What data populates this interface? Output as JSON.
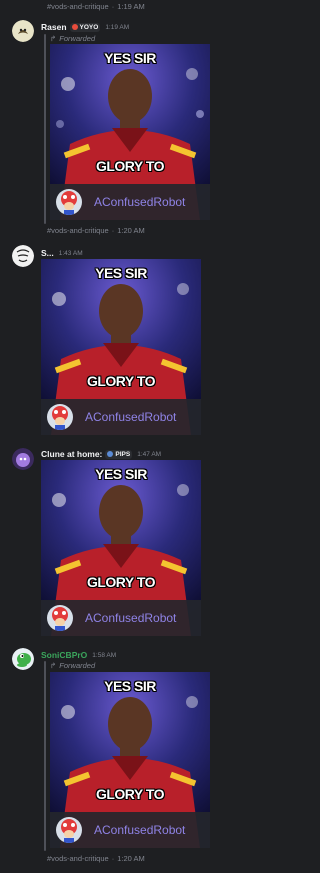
{
  "channel": {
    "prefix": "#",
    "name": "vods-and-critique",
    "separator": "·"
  },
  "messages": [
    {
      "author": "Rasen",
      "tag": "YOYO",
      "time": "1:19 AM",
      "forwarded_label": "Forwarded",
      "footer_channel": "#vods-and-critique",
      "footer_time": "1:20 AM",
      "meme": {
        "top": "YES SIR",
        "bottom": "GLORY TO",
        "name": "AConfusedRobot"
      }
    },
    {
      "author": "S...",
      "tag": "",
      "time": "1:43 AM",
      "meme": {
        "top": "YES SIR",
        "bottom": "GLORY TO",
        "name": "AConfusedRobot"
      }
    },
    {
      "author": "Clune at home:",
      "tag": "PIPS",
      "time": "1:47 AM",
      "meme": {
        "top": "YES SIR",
        "bottom": "GLORY TO",
        "name": "AConfusedRobot"
      }
    },
    {
      "author": "SoniCBPrO",
      "tag": "",
      "time": "1:58 AM",
      "forwarded_label": "Forwarded",
      "footer_channel": "#vods-and-critique",
      "footer_time": "1:20 AM",
      "meme": {
        "top": "YES SIR",
        "bottom": "GLORY TO",
        "name": "AConfusedRobot"
      }
    }
  ],
  "top_channel_ref": {
    "channel": "#vods-and-critique",
    "time": "1:19 AM"
  },
  "icons": {
    "avatar_1": "cat-avatar-icon",
    "avatar_2": "sketch-avatar-icon",
    "avatar_3": "purple-character-avatar-icon",
    "avatar_4": "yoshi-avatar-icon",
    "forward": "forward-arrow-icon",
    "robot": "toad-avatar-icon"
  },
  "colors": {
    "background": "#1e1f22",
    "muted": "#80848e",
    "robot_name": "#8f83e6",
    "green_name": "#3ba55c"
  }
}
